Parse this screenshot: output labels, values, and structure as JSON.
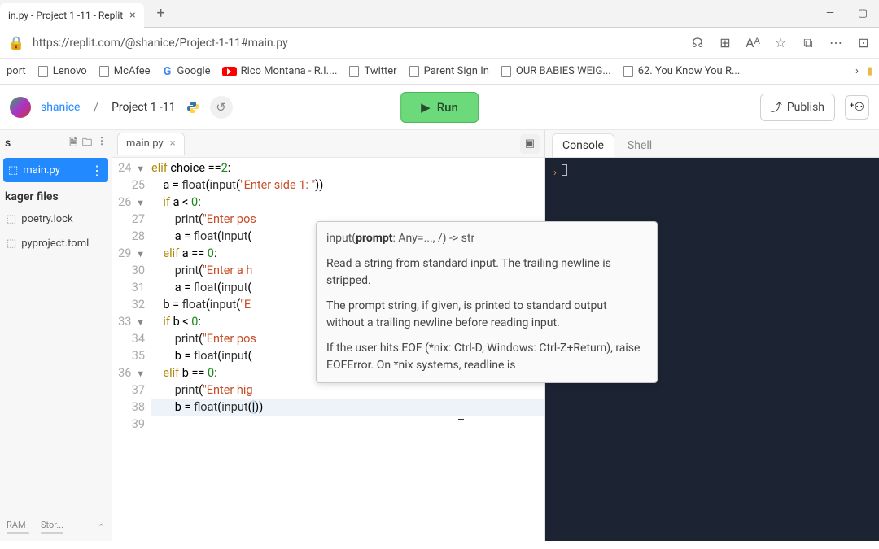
{
  "browser": {
    "tab_title": "in.py - Project 1 -11 - Replit",
    "url": "https://replit.com/@shanice/Project-1-11#main.py"
  },
  "bookmarks": {
    "b0": "port",
    "b1": "Lenovo",
    "b2": "McAfee",
    "b3": "Google",
    "b4": "Rico Montana - R.I....",
    "b5": "Twitter",
    "b6": "Parent Sign In",
    "b7": "OUR BABIES WEIG...",
    "b8": "62. You Know You R..."
  },
  "header": {
    "user": "shanice",
    "project": "Project 1 -11",
    "run": "Run",
    "publish": "Publish"
  },
  "sidebar": {
    "heading_suffix": "s",
    "files": {
      "main": "main.py"
    },
    "section": "kager files",
    "pkg": {
      "poetry": "poetry.lock",
      "pyproj": "pyproject.toml"
    },
    "footer": {
      "ram": "RAM",
      "stor": "Stor..."
    }
  },
  "editor": {
    "tab": "main.py",
    "gutter": [
      "24",
      "25",
      "26",
      "27",
      "28",
      "29",
      "30",
      "31",
      "32",
      "33",
      "34",
      "35",
      "36",
      "37",
      "38",
      "39"
    ],
    "fold_rows": [
      0,
      2,
      5,
      9,
      12
    ]
  },
  "code": {
    "l24a": "elif",
    "l24b": " choice ==",
    "l24c": "2",
    "l24d": ":",
    "l25a": "    a = ",
    "l25b": "float",
    "l25c": "(",
    "l25d": "input",
    "l25e": "(",
    "l25f": "\"Enter side 1: \"",
    "l25g": "))",
    "l26a": "if",
    "l26b": " a < ",
    "l26c": "0",
    "l26d": ":",
    "l27a": "print",
    "l27b": "(",
    "l27c": "\"Enter pos",
    "l28a": "        a = ",
    "l28b": "float",
    "l28c": "(",
    "l28d": "input",
    "l28e": "(",
    "l29a": "elif",
    "l29b": " a == ",
    "l29c": "0",
    "l29d": ":",
    "l30a": "print",
    "l30b": "(",
    "l30c": "\"Enter a h",
    "l31a": "        a = ",
    "l31b": "float",
    "l31c": "(",
    "l31d": "input",
    "l31e": "(",
    "l32a": "    b = ",
    "l32b": "float",
    "l32c": "(",
    "l32d": "input",
    "l32e": "(",
    "l32f": "\"E",
    "l33a": "if",
    "l33b": " b < ",
    "l33c": "0",
    "l33d": ":",
    "l34a": "print",
    "l34b": "(",
    "l34c": "\"Enter pos",
    "l35a": "        b = ",
    "l35b": "float",
    "l35c": "(",
    "l35d": "input",
    "l35e": "(",
    "l36a": "elif",
    "l36b": " b == ",
    "l36c": "0",
    "l36d": ":",
    "l37a": "print",
    "l37b": "(",
    "l37c": "\"Enter hig",
    "l38a": "        b = ",
    "l38b": "float",
    "l38c": "(",
    "l38d": "input",
    "l38e": "(",
    "l38f": ")",
    ")": ")"
  },
  "tooltip": {
    "sig_pre": "input(",
    "sig_bold": "prompt",
    "sig_post": ": Any=..., /) -> str",
    "p1": "Read a string from standard input.  The trailing newline is stripped.",
    "p2": "The prompt string, if given, is printed to standard output without a trailing newline before reading input.",
    "p3": "If the user hits EOF (*nix: Ctrl-D, Windows: Ctrl-Z+Return), raise EOFError. On *nix systems, readline is"
  },
  "console": {
    "tab_console": "Console",
    "tab_shell": "Shell"
  }
}
